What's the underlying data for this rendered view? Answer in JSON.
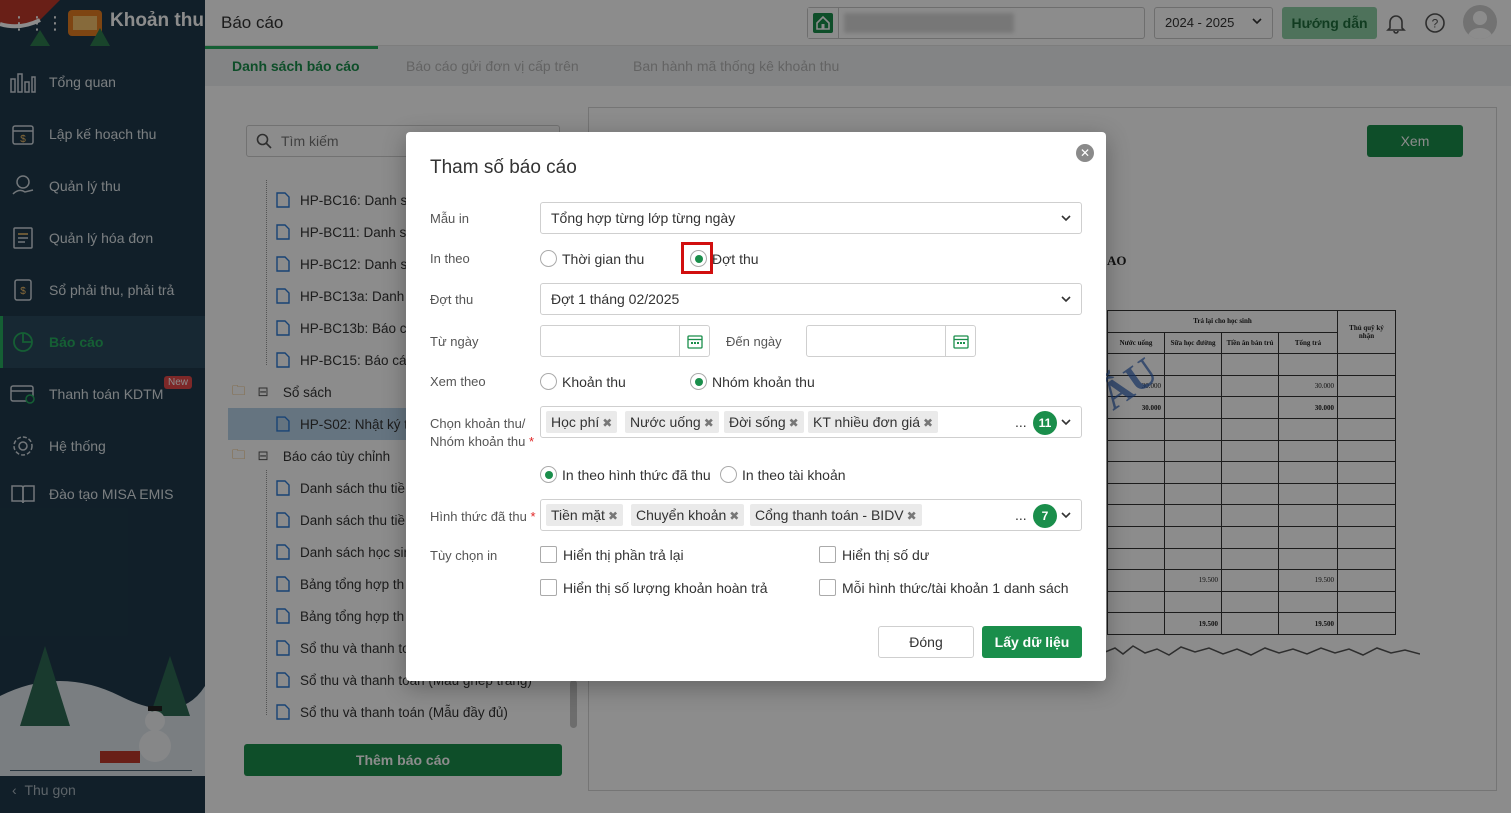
{
  "app": {
    "title": "Khoản thu",
    "page_title": "Báo cáo"
  },
  "header": {
    "year": "2024 - 2025",
    "guide_label": "Hướng dẫn"
  },
  "sidebar": {
    "items": [
      {
        "label": "Tổng quan",
        "icon": "chart-bars-icon"
      },
      {
        "label": "Lập kế hoạch thu",
        "icon": "calendar-money-icon"
      },
      {
        "label": "Quản lý thu",
        "icon": "hand-money-icon"
      },
      {
        "label": "Quản lý hóa đơn",
        "icon": "invoice-icon"
      },
      {
        "label": "Sổ phải thu, phải trả",
        "icon": "ledger-icon"
      },
      {
        "label": "Báo cáo",
        "icon": "pie-chart-icon"
      },
      {
        "label": "Thanh toán KDTM",
        "icon": "card-payment-icon"
      },
      {
        "label": "Hệ thống",
        "icon": "gear-icon"
      },
      {
        "label": "Đào tạo MISA EMIS",
        "icon": "book-icon"
      }
    ],
    "new_badge": "New",
    "collapse_label": "Thu gọn"
  },
  "tabs": [
    {
      "label": "Danh sách báo cáo"
    },
    {
      "label": "Báo cáo gửi đơn vị cấp trên"
    },
    {
      "label": "Ban hành mã thống kê khoản thu"
    }
  ],
  "report_list": {
    "search_placeholder": "Tìm kiếm",
    "items_top": [
      "HP-BC16: Danh sá",
      "HP-BC11: Danh sá",
      "HP-BC12: Danh sá",
      "HP-BC13a: Danh s",
      "HP-BC13b: Báo cá",
      "HP-BC15: Báo cáo"
    ],
    "group_books": "Sổ sách",
    "book_item": "HP-S02: Nhật ký t",
    "group_custom": "Báo cáo tùy chỉnh",
    "custom_items": [
      "Danh sách thu tiề",
      "Danh sách thu tiề",
      "Danh sách học sin",
      "Bảng tổng hợp th",
      "Bảng tổng hợp th",
      "Sổ thu và thanh to",
      "Sổ thu và thanh toán (Mẫu ghép trang)",
      "Sổ thu và thanh toán (Mẫu đầy đủ)"
    ],
    "add_button": "Thêm báo cáo"
  },
  "preview": {
    "view_button": "Xem",
    "title_fragment": "AO",
    "stamp_text": "ẪU",
    "table_headers": {
      "group": "Trả lại cho học sinh",
      "cols": [
        "Nước uống",
        "Sữa học đường",
        "Tiền ăn bán trú",
        "Tổng trả"
      ],
      "last": "Thủ quỹ ký nhận"
    },
    "rows": [
      [
        "",
        "",
        "",
        "",
        ""
      ],
      [
        "30.000",
        "",
        "",
        "30.000",
        ""
      ],
      [
        "30.000",
        "",
        "",
        "30.000",
        ""
      ],
      [
        "",
        "",
        "",
        "",
        ""
      ],
      [
        "",
        "",
        "",
        "",
        ""
      ],
      [
        "",
        "",
        "",
        "",
        ""
      ],
      [
        "",
        "",
        "",
        "",
        ""
      ],
      [
        "",
        "",
        "",
        "",
        ""
      ],
      [
        "",
        "",
        "",
        "",
        ""
      ],
      [
        "",
        "",
        "",
        "",
        ""
      ],
      [
        "",
        "19.500",
        "",
        "19.500",
        ""
      ],
      [
        "",
        "",
        "",
        "",
        ""
      ],
      [
        "",
        "19.500",
        "",
        "19.500",
        ""
      ]
    ]
  },
  "modal": {
    "title": "Tham số báo cáo",
    "mau_in_label": "Mẫu in",
    "mau_in_value": "Tổng hợp từng lớp từng ngày",
    "in_theo_label": "In theo",
    "in_theo_options": [
      "Thời gian thu",
      "Đợt thu"
    ],
    "dot_thu_label": "Đợt thu",
    "dot_thu_value": "Đợt 1 tháng 02/2025",
    "tu_ngay_label": "Từ ngày",
    "den_ngay_label": "Đến ngày",
    "xem_theo_label": "Xem theo",
    "xem_theo_options": [
      "Khoản thu",
      "Nhóm khoản thu"
    ],
    "chon_khoan_thu_label": "Chọn khoản thu/",
    "chon_khoan_thu_label2": "Nhóm khoản thu",
    "khoan_thu_tags": [
      "Học phí",
      "Nước uống",
      "Đời sống",
      "KT nhiều đơn giá"
    ],
    "khoan_thu_more": "...",
    "khoan_thu_count": "11",
    "print_mode_options": [
      "In theo hình thức đã thu",
      "In theo tài khoản"
    ],
    "hinh_thuc_label": "Hình thức đã thu",
    "hinh_thuc_tags": [
      "Tiền mặt",
      "Chuyển khoản",
      "Cổng thanh toán - BIDV"
    ],
    "hinh_thuc_more": "...",
    "hinh_thuc_count": "7",
    "tuy_chon_label": "Tùy chọn in",
    "options": [
      "Hiển thị phần trả lại",
      "Hiển thị số dư",
      "Hiển thị số lượng khoản hoàn trả",
      "Mỗi hình thức/tài khoản 1 danh sách"
    ],
    "close_button": "Đóng",
    "submit_button": "Lấy dữ liệu"
  },
  "colors": {
    "brand_green": "#1a8e4b",
    "sidebar_bg": "#1f3a4b",
    "highlight_red": "#d10f0f"
  }
}
